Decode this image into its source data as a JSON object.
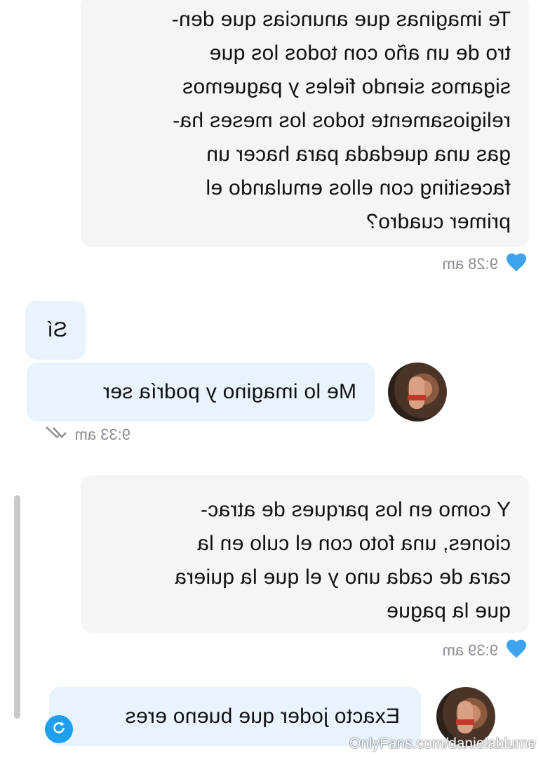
{
  "messages": [
    {
      "side": "incoming",
      "lines": [
        "Te imaginas que anuncias que den-",
        "tro de un año con todos los que",
        "sigamos siendo fieles y paguemos",
        "religiosamente todos los meses ha-",
        "gas una quedada para hacer un",
        "facesiting con ellos emulando el",
        "primer cuadro?"
      ],
      "time": "9:28 am",
      "liked": true
    },
    {
      "side": "outgoing",
      "text": "Sí"
    },
    {
      "side": "outgoing",
      "text": "Me lo imagino y podría ser",
      "time": "9:33 am",
      "status": "read"
    },
    {
      "side": "incoming",
      "lines": [
        "Y como en los parques de atrac-",
        "ciones, una foto con el culo en la",
        "cara de cada uno y el que la quiera",
        "que la pague"
      ],
      "time": "9:39 am",
      "liked": true
    },
    {
      "side": "outgoing",
      "text": "Exacto joder que bueno eres"
    }
  ],
  "watermark": "OnlyFans.com/danielablume",
  "colors": {
    "accent": "#1fa0ee",
    "heart": "#3ea3ee",
    "incoming_bg": "#f4f5f7",
    "outgoing_bg": "#e8f3fe"
  },
  "icons": {
    "like": "heart-icon",
    "read": "double-check-icon",
    "refresh": "refresh-icon"
  }
}
